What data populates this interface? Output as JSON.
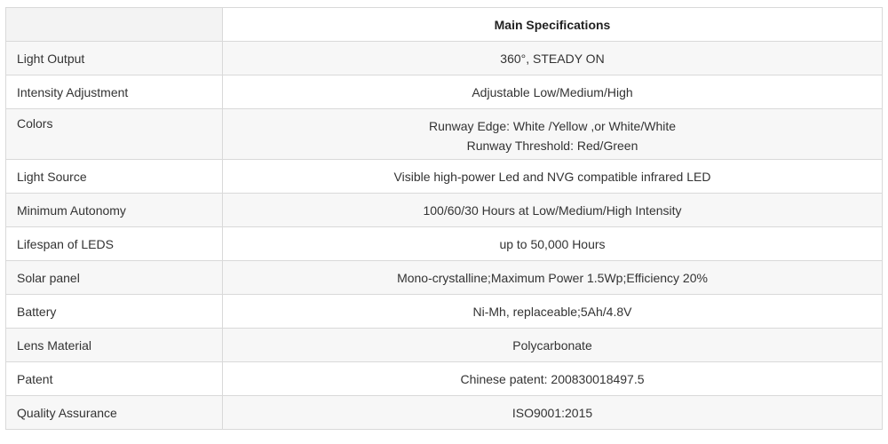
{
  "table": {
    "header": {
      "col1": "",
      "col2": "Main Specifications"
    },
    "rows": [
      {
        "label": "Light Output",
        "value": [
          "360°, STEADY ON"
        ]
      },
      {
        "label": "Intensity Adjustment",
        "value": [
          "Adjustable Low/Medium/High"
        ]
      },
      {
        "label": "Colors",
        "value": [
          "Runway Edge: White /Yellow ,or White/White",
          "Runway Threshold: Red/Green"
        ]
      },
      {
        "label": "Light Source",
        "value": [
          "Visible high-power Led and NVG compatible infrared LED"
        ]
      },
      {
        "label": "Minimum Autonomy",
        "value": [
          "100/60/30 Hours at Low/Medium/High Intensity"
        ]
      },
      {
        "label": "Lifespan of LEDS",
        "value": [
          "up to 50,000 Hours"
        ]
      },
      {
        "label": "Solar panel",
        "value": [
          "Mono-crystalline;Maximum Power 1.5Wp;Efficiency 20%"
        ]
      },
      {
        "label": "Battery",
        "value": [
          "Ni-Mh, replaceable;5Ah/4.8V"
        ]
      },
      {
        "label": "Lens Material",
        "value": [
          "Polycarbonate"
        ]
      },
      {
        "label": "Patent",
        "value": [
          "Chinese patent: 200830018497.5"
        ]
      },
      {
        "label": "Quality Assurance",
        "value": [
          "ISO9001:2015"
        ]
      }
    ]
  }
}
